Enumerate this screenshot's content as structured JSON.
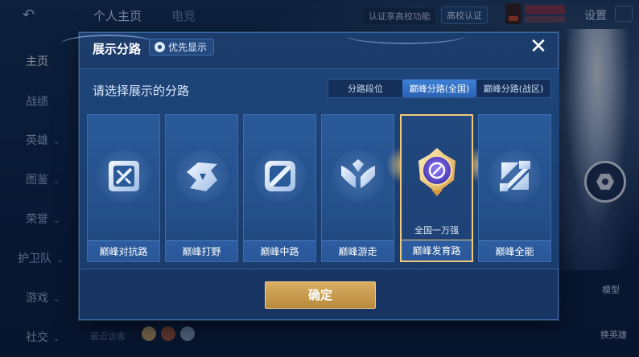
{
  "background": {
    "top_tabs": [
      "个人主页",
      "电竞"
    ],
    "cert_text": "认证享高校功能",
    "school_badge": "高校认证",
    "settings": "设置",
    "nav": [
      {
        "label": "主页",
        "active": true
      },
      {
        "label": "战绩"
      },
      {
        "label": "英雄"
      },
      {
        "label": "图鉴"
      },
      {
        "label": "荣誉"
      },
      {
        "label": "护卫队"
      },
      {
        "label": "游戏"
      },
      {
        "label": "社交"
      }
    ],
    "model_label": "模型",
    "swap_label": "换英雄",
    "visitors_label": "最近访客"
  },
  "modal": {
    "title": "展示分路",
    "priority_label": "优先显示",
    "close_icon": "close-icon",
    "instruction": "请选择展示的分路",
    "segments": [
      {
        "label": "分路段位",
        "active": false
      },
      {
        "label": "巅峰分路(全国)",
        "active": true
      },
      {
        "label": "巅峰分路(战区)",
        "active": false
      }
    ],
    "cards": [
      {
        "label": "巅峰对抗路",
        "icon": "clash-lane-icon"
      },
      {
        "label": "巅峰打野",
        "icon": "jungle-icon"
      },
      {
        "label": "巅峰中路",
        "icon": "mid-lane-icon"
      },
      {
        "label": "巅峰游走",
        "icon": "roam-icon"
      },
      {
        "label": "巅峰发育路",
        "icon": "farm-lane-rank-badge",
        "selected": true,
        "rank": "全国一万强"
      },
      {
        "label": "巅峰全能",
        "icon": "all-round-icon"
      }
    ],
    "confirm_label": "确定"
  },
  "colors": {
    "accent_blue": "#2a63b5",
    "gold_border": "#f2c97a",
    "confirm_gold": "#c99a4e"
  }
}
